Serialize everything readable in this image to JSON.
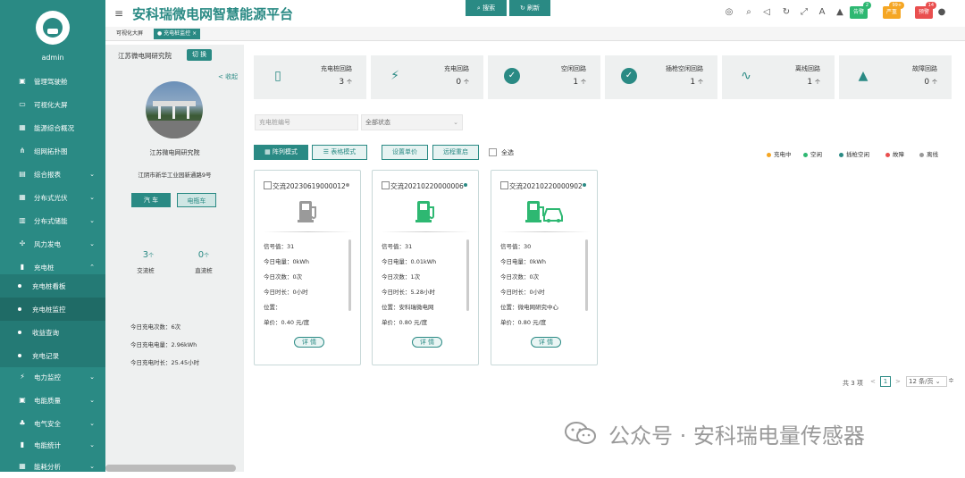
{
  "app": {
    "title": "安科瑞微电网智慧能源平台",
    "user": "admin"
  },
  "sidebar": {
    "items": [
      {
        "label": "管理驾驶舱",
        "icon": "dashboard-icon"
      },
      {
        "label": "可视化大屏",
        "icon": "monitor-icon"
      },
      {
        "label": "能源综合概况",
        "icon": "grid-icon"
      },
      {
        "label": "组网拓扑图",
        "icon": "topology-icon"
      },
      {
        "label": "综合报表",
        "icon": "report-icon"
      },
      {
        "label": "分布式光伏",
        "icon": "solar-icon"
      },
      {
        "label": "分布式储能",
        "icon": "storage-icon"
      },
      {
        "label": "风力发电",
        "icon": "wind-icon"
      },
      {
        "label": "充电桩",
        "icon": "charger-icon"
      }
    ],
    "sub_items": [
      "充电桩看板",
      "充电桩监控",
      "收益查询",
      "充电记录"
    ],
    "bottom_items": [
      "电力监控",
      "电能质量",
      "电气安全",
      "电能统计",
      "能耗分析"
    ]
  },
  "header": {
    "buttons": [
      {
        "label": "告警",
        "badge": "2",
        "color": "#2eb872"
      },
      {
        "label": "严重",
        "badge": "99+",
        "color": "#f5a623"
      },
      {
        "label": "预警",
        "badge": "14",
        "color": "#e94f4f"
      }
    ]
  },
  "tabs": [
    {
      "label": "可视化大屏",
      "active": false
    },
    {
      "label": "充电桩监控",
      "active": true,
      "close": "×"
    }
  ],
  "station": {
    "org": "江苏微电网研究院",
    "switch_label": "切 换",
    "collapse_label": "收起",
    "name": "江苏微电网研究院",
    "address": "江阴市新华工业园新通路9号",
    "type_buttons": [
      "汽 车",
      "电瓶车"
    ],
    "ac": {
      "value": "3",
      "unit": "个",
      "label": "交流桩"
    },
    "dc": {
      "value": "0",
      "unit": "个",
      "label": "直流桩"
    },
    "today": [
      {
        "label": "今日充电次数：",
        "value": "6次"
      },
      {
        "label": "今日充电电量：",
        "value": "2.96kWh"
      },
      {
        "label": "今日充电时长：",
        "value": "25.45小时"
      }
    ]
  },
  "summary": [
    {
      "label": "充电桩回路",
      "value": "3",
      "unit": "个",
      "icon": "charger-icon"
    },
    {
      "label": "充电回路",
      "value": "0",
      "unit": "个",
      "icon": "lightning-icon"
    },
    {
      "label": "空闲回路",
      "value": "1",
      "unit": "个",
      "icon": "check-circle-icon"
    },
    {
      "label": "插枪空闲回路",
      "value": "1",
      "unit": "个",
      "icon": "check-circle-icon"
    },
    {
      "label": "离线回路",
      "value": "1",
      "unit": "个",
      "icon": "plug-icon"
    },
    {
      "label": "故障回路",
      "value": "0",
      "unit": "个",
      "icon": "warning-icon"
    }
  ],
  "filters": {
    "pile_placeholder": "充电桩编号",
    "status_value": "全部状态",
    "search_label": "搜索",
    "refresh_label": "刷新"
  },
  "toolbar": {
    "grid_mode": "阵列模式",
    "table_mode": "表格模式",
    "set_price": "设置单价",
    "remote_restart": "远程重启",
    "select_all": "全选"
  },
  "legend": [
    {
      "label": "充电中",
      "color": "#f5a623"
    },
    {
      "label": "空闲",
      "color": "#2eb872"
    },
    {
      "label": "插枪空闲",
      "color": "#2a8a84"
    },
    {
      "label": "故障",
      "color": "#e94f4f"
    },
    {
      "label": "离线",
      "color": "#999999"
    }
  ],
  "piles": [
    {
      "name": "交流20230619000012",
      "status_color": "#999999",
      "icon_color": "#9a9a9a",
      "signal": "信号值：31",
      "energy": "今日电量：0kWh",
      "count": "今日次数：0次",
      "duration": "今日时长：0小时",
      "location": "位置：",
      "price": "单价：0.40 元/度",
      "detail": "详 情"
    },
    {
      "name": "交流20210220000006",
      "status_color": "#2a8a84",
      "icon_color": "#2eb872",
      "signal": "信号值：31",
      "energy": "今日电量：0.01kWh",
      "count": "今日次数：1次",
      "duration": "今日时长：5.28小时",
      "location": "位置：安科瑞微电网",
      "price": "单价：0.80 元/度",
      "detail": "详 情"
    },
    {
      "name": "交流20210220000902",
      "status_color": "#2a8a84",
      "icon_color": "#2eb872",
      "signal": "信号值：30",
      "energy": "今日电量：0kWh",
      "count": "今日次数：0次",
      "duration": "今日时长：0小时",
      "location": "位置：微电网研究中心",
      "price": "单价：0.80 元/度",
      "detail": "详 情"
    }
  ],
  "pagination": {
    "total": "共 3 项",
    "prev": "<",
    "current": "1",
    "next": ">",
    "size": "12 条/页"
  },
  "watermark": {
    "text": "公众号 · 安科瑞电量传感器"
  }
}
